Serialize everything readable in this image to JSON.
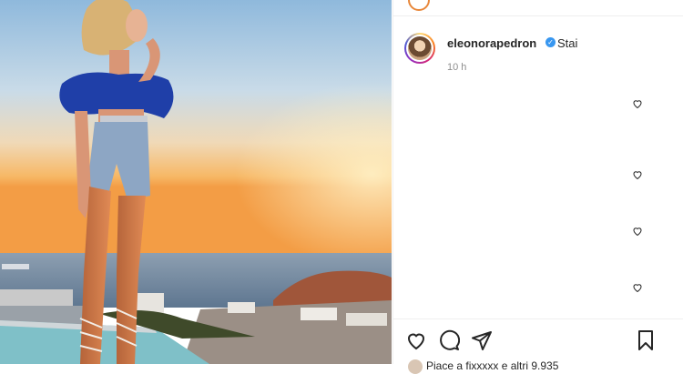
{
  "post": {
    "username": "eleonorapedron",
    "caption": "Stai",
    "time_ago": "10 h"
  },
  "comments_like_icons": [
    "heart-icon",
    "heart-icon",
    "heart-icon",
    "heart-icon"
  ],
  "actions": {
    "like": "heart-icon",
    "comment": "comment-icon",
    "share": "share-icon",
    "save": "bookmark-icon"
  },
  "likes_line": "Piace a fixxxxx e altri 9.935",
  "colors": {
    "sky_top": "#9fc3de",
    "sunset": "#f6a24a",
    "sea": "#6f8aa6",
    "verified": "#3897f0"
  }
}
